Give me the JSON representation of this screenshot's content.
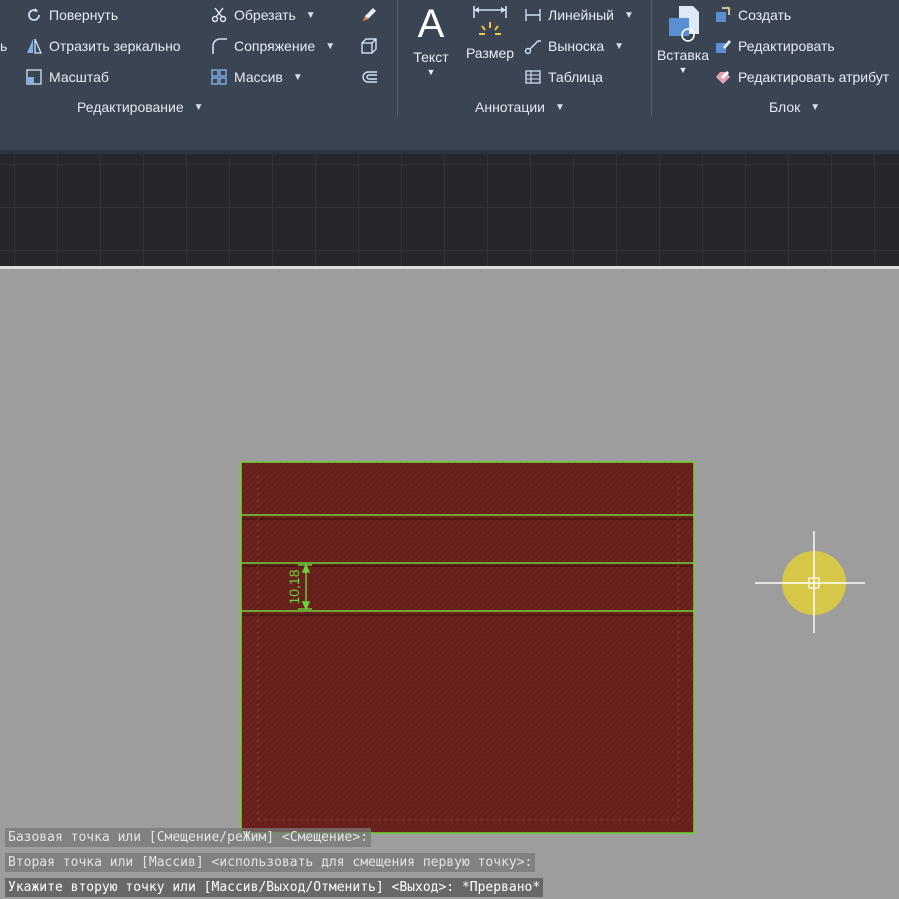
{
  "ribbon": {
    "modify": {
      "cut_label": "ь",
      "rotate": "Повернуть",
      "mirror": "Отразить зеркально",
      "scale": "Масштаб",
      "trim": "Обрезать",
      "fillet": "Сопряжение",
      "array": "Массив",
      "title": "Редактирование"
    },
    "annotation": {
      "text": "Текст",
      "dimension": "Размер",
      "linear": "Линейный",
      "leader": "Выноска",
      "table": "Таблица",
      "title": "Аннотации"
    },
    "block": {
      "insert": "Вставка",
      "create": "Создать",
      "edit": "Редактировать",
      "edit_attributes": "Редактировать атрибут",
      "title": "Блок"
    }
  },
  "drawing": {
    "dimension_value": "10,18",
    "wallet_color": "#6b221d",
    "highlight_color": "#6cd13a"
  },
  "command_line": {
    "history": [
      "Базовая точка или [Смещение/реЖим] <Смещение>:",
      "Вторая точка или [Массив] <использовать для смещения первую точку>:"
    ],
    "current": "Укажите вторую точку или [Массив/Выход/Отменить] <Выход>: *Прервано*"
  },
  "colors": {
    "ribbon_bg": "#3b4453",
    "canvas_bg": "#9d9d9d",
    "dark_area_bg": "#25272b",
    "cursor_highlight": "#e0cf3a"
  }
}
